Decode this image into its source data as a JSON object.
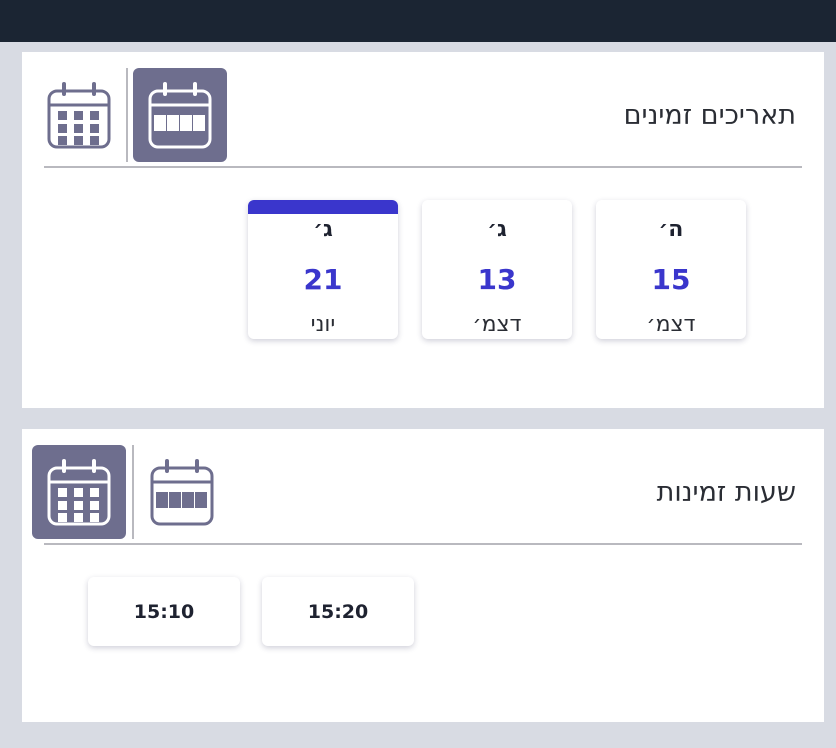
{
  "colors": {
    "topbar": "#1b2533",
    "background": "#d8dbe3",
    "accent": "#3a36cc",
    "active_toggle": "#6e6e8e"
  },
  "dates_section": {
    "title": "תאריכים זמינים",
    "view_toggle": {
      "list_view_icon": "calendar-week-icon",
      "month_view_icon": "calendar-month-icon",
      "active": "list"
    },
    "dates": [
      {
        "day": "ה׳",
        "number": "15",
        "month": "דצמ׳",
        "selected": false
      },
      {
        "day": "ג׳",
        "number": "13",
        "month": "דצמ׳",
        "selected": false
      },
      {
        "day": "ג׳",
        "number": "21",
        "month": "יוני",
        "selected": true
      }
    ]
  },
  "hours_section": {
    "title": "שעות זמינות",
    "view_toggle": {
      "list_view_icon": "calendar-week-icon",
      "month_view_icon": "calendar-month-icon",
      "active": "grid"
    },
    "times": [
      "15:20",
      "15:10"
    ]
  }
}
